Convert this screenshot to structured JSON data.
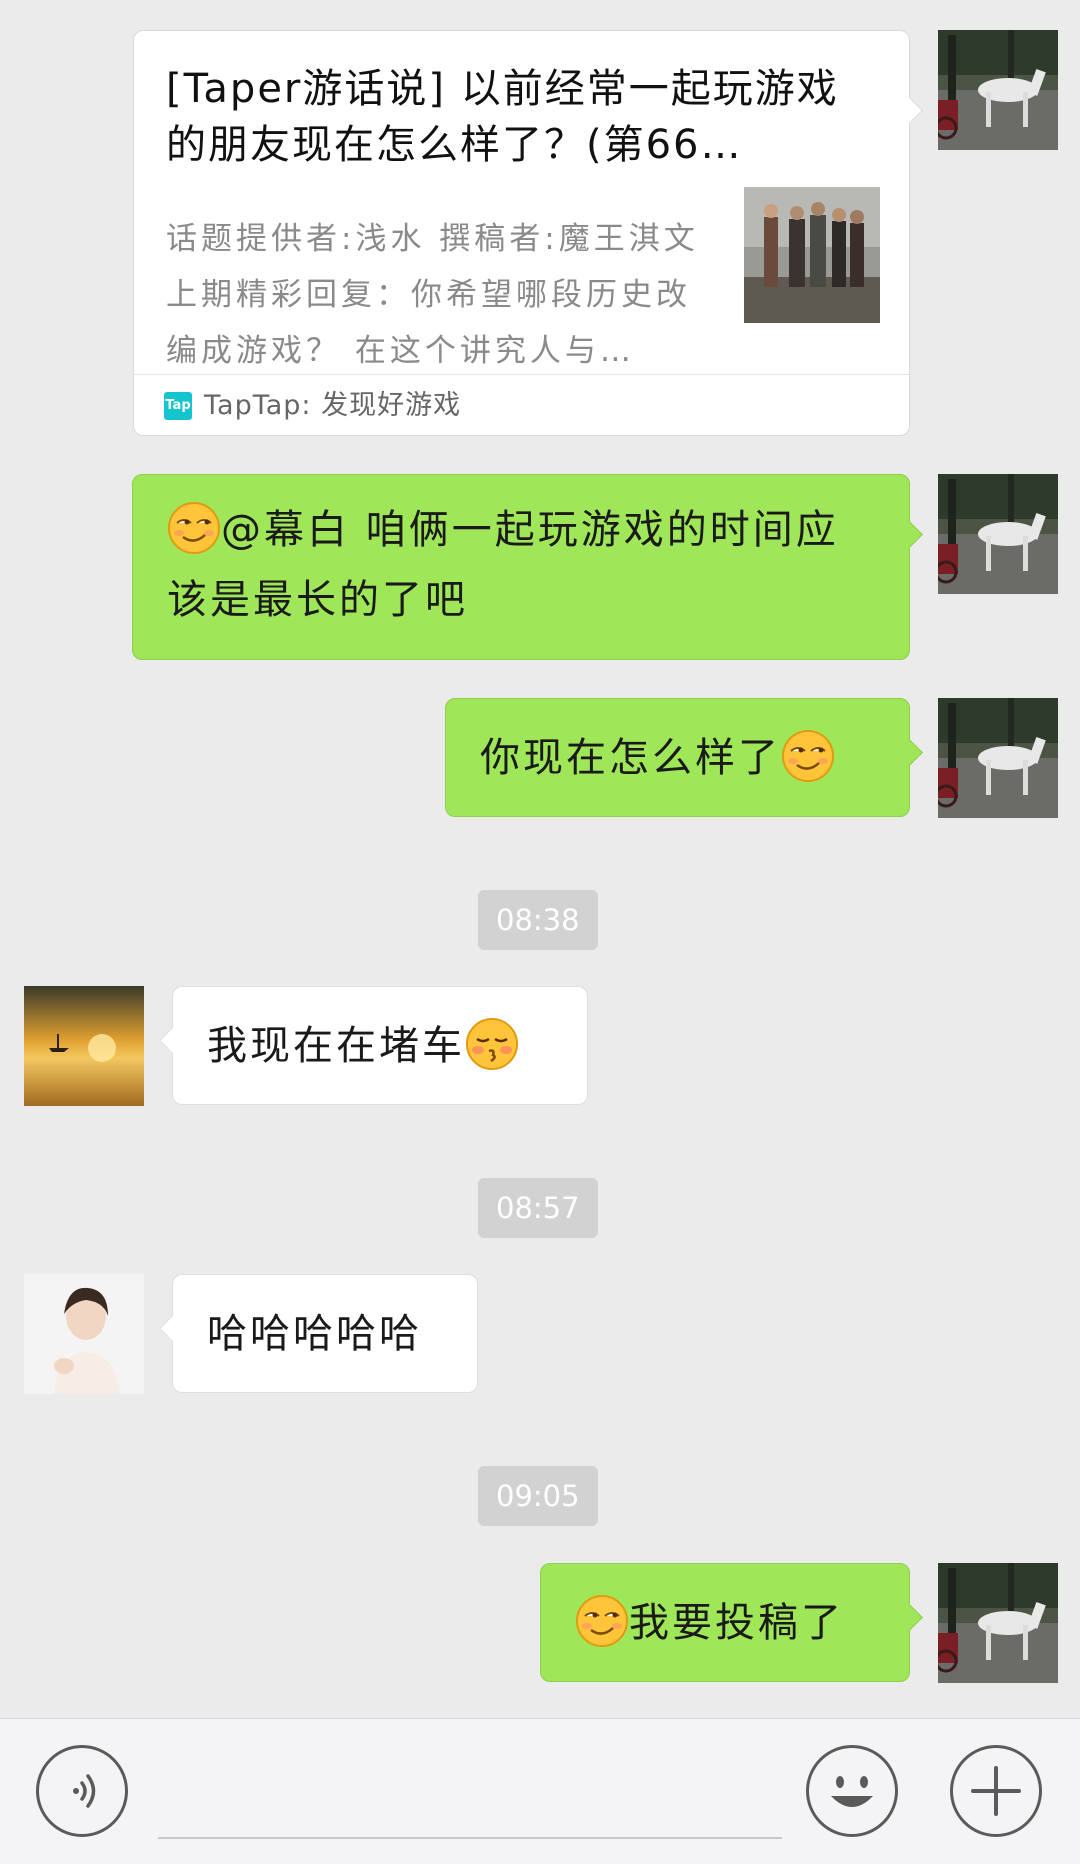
{
  "card": {
    "title": "[Taper游话说] 以前经常一起玩游戏的朋友现在怎么样了？(第66…",
    "description": "话题提供者:浅水  撰稿者:魔王淇文 上期精彩回复：你希望哪段历史改编成游戏？ 在这个讲究人与…",
    "source_logo": "Tap",
    "source": "TapTap: 发现好游戏"
  },
  "messages": {
    "m1": "@幕白  咱俩一起玩游戏的时间应该是最长的了吧",
    "m2": "你现在怎么样了",
    "m3": "我现在在堵车",
    "m4": "哈哈哈哈哈",
    "m5": "我要投稿了"
  },
  "times": {
    "t1": "08:38",
    "t2": "08:57",
    "t3": "09:05"
  },
  "icons": {
    "voice": "voice-icon",
    "emoji": "emoji-icon",
    "add": "plus-icon"
  },
  "colors": {
    "sent_bubble": "#9fe658",
    "received_bubble": "#ffffff",
    "background": "#ebebeb",
    "time_badge": "#d2d2d2"
  }
}
